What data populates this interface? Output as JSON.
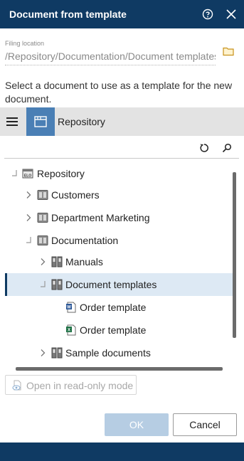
{
  "dialog": {
    "title": "Document from template",
    "help_icon": "help-circle-icon",
    "close_icon": "close-icon"
  },
  "filing": {
    "label": "Filing location",
    "value": "/Repository/Documentation/Document templates",
    "folder_icon": "folder-icon"
  },
  "instruction": "Select a document to use as a template for the new document.",
  "repository_bar": {
    "menu_icon": "hamburger-menu-icon",
    "tab_icon": "repository-window-icon",
    "label": "Repository"
  },
  "toolbar": {
    "refresh_icon": "refresh-icon",
    "search_icon": "search-icon"
  },
  "tree": {
    "items": [
      {
        "label": "Repository",
        "icon": "repository-root-icon",
        "expander": "expanded",
        "level": 0
      },
      {
        "label": "Customers",
        "icon": "cabinet-icon",
        "expander": "collapsed",
        "level": 1
      },
      {
        "label": "Department Marketing",
        "icon": "cabinet-icon",
        "expander": "collapsed",
        "level": 1
      },
      {
        "label": "Documentation",
        "icon": "cabinet-icon",
        "expander": "expanded",
        "level": 1
      },
      {
        "label": "Manuals",
        "icon": "binder-icon",
        "expander": "collapsed",
        "level": 2
      },
      {
        "label": "Document templates",
        "icon": "binder-icon",
        "expander": "expanded",
        "level": 2,
        "selected": true
      },
      {
        "label": "Order template",
        "icon": "word-document-icon",
        "expander": "none",
        "level": 3
      },
      {
        "label": "Order template",
        "icon": "excel-document-icon",
        "expander": "none",
        "level": 3
      },
      {
        "label": "Sample documents",
        "icon": "binder-icon",
        "expander": "collapsed",
        "level": 2
      }
    ]
  },
  "readonly_button": {
    "label": "Open in read-only mode",
    "icon": "eye-document-icon"
  },
  "buttons": {
    "ok": "OK",
    "cancel": "Cancel"
  },
  "colors": {
    "titlebar": "#0f3a63",
    "selection": "#dde9f4",
    "accent": "#4a7fb5",
    "ok_disabled": "#b6cde3"
  }
}
